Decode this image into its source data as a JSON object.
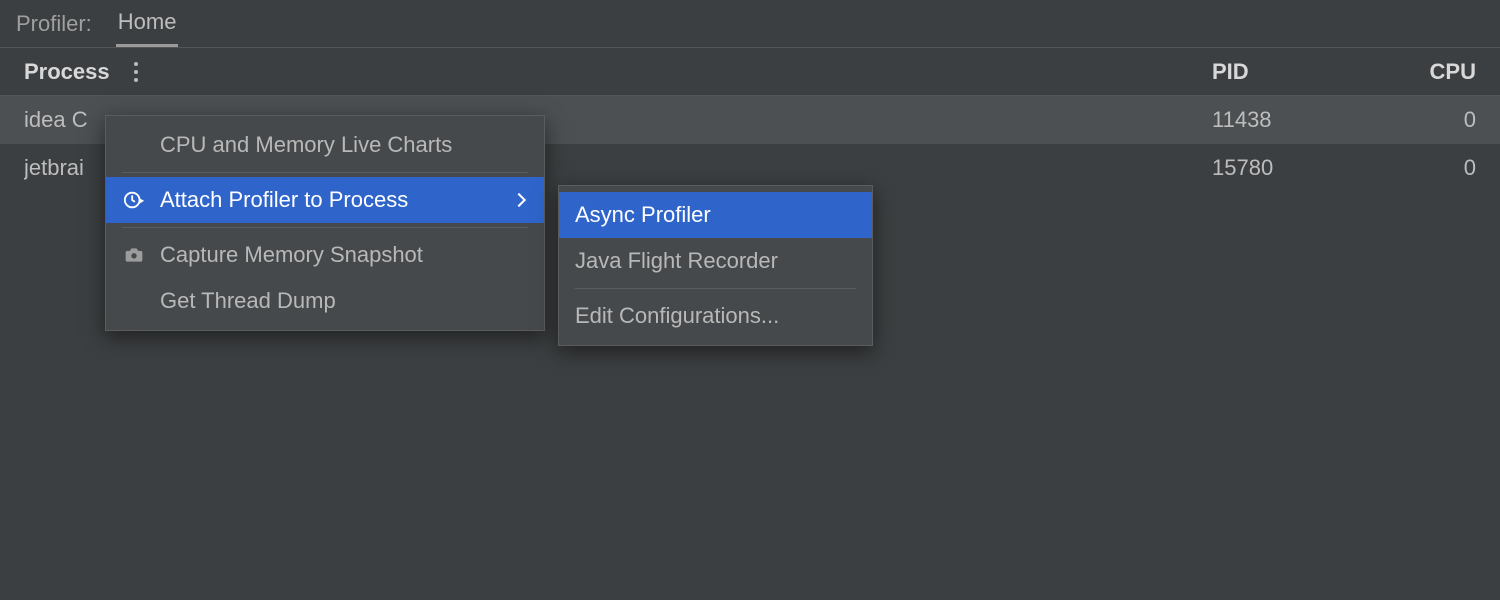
{
  "tabbar": {
    "prefix": "Profiler:",
    "tabs": [
      {
        "label": "Home",
        "active": true
      }
    ]
  },
  "table": {
    "headers": {
      "process": "Process",
      "pid": "PID",
      "cpu": "CPU"
    },
    "rows": [
      {
        "process": "idea C",
        "pid": "11438",
        "cpu": "0",
        "hover": true
      },
      {
        "process": "jetbrai",
        "pid": "15780",
        "cpu": "0",
        "hover": false
      }
    ]
  },
  "contextMenu": {
    "items": [
      {
        "label": "CPU and Memory Live Charts",
        "icon": null,
        "submenu": false,
        "selected": false
      },
      {
        "sep": true
      },
      {
        "label": "Attach Profiler to Process",
        "icon": "clock-play",
        "submenu": true,
        "selected": true
      },
      {
        "sep": true
      },
      {
        "label": "Capture Memory Snapshot",
        "icon": "camera",
        "submenu": false,
        "selected": false
      },
      {
        "label": "Get Thread Dump",
        "icon": null,
        "submenu": false,
        "selected": false
      }
    ]
  },
  "submenu": {
    "items": [
      {
        "label": "Async Profiler",
        "selected": true
      },
      {
        "label": "Java Flight Recorder",
        "selected": false
      },
      {
        "sep": true
      },
      {
        "label": "Edit Configurations...",
        "selected": false
      }
    ]
  }
}
